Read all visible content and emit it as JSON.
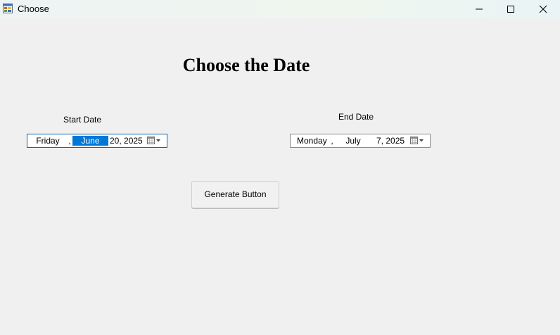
{
  "window": {
    "title": "Choose",
    "icon": "app-window-icon",
    "controls": {
      "minimize": "minimize-icon",
      "maximize": "maximize-icon",
      "close": "close-icon"
    }
  },
  "main": {
    "heading": "Choose the Date",
    "start": {
      "label": "Start Date",
      "weekday": "Friday",
      "sep": ",",
      "month": "June",
      "day_year": "20, 2025",
      "selected_segment": "month"
    },
    "end": {
      "label": "End Date",
      "weekday": "Monday",
      "sep": ",",
      "month": "July",
      "day_year": "7, 2025"
    },
    "generate_button": "Generate Button"
  },
  "colors": {
    "selection": "#0078d7",
    "background": "#f0f0f0",
    "focus_border": "#0a64ad"
  }
}
